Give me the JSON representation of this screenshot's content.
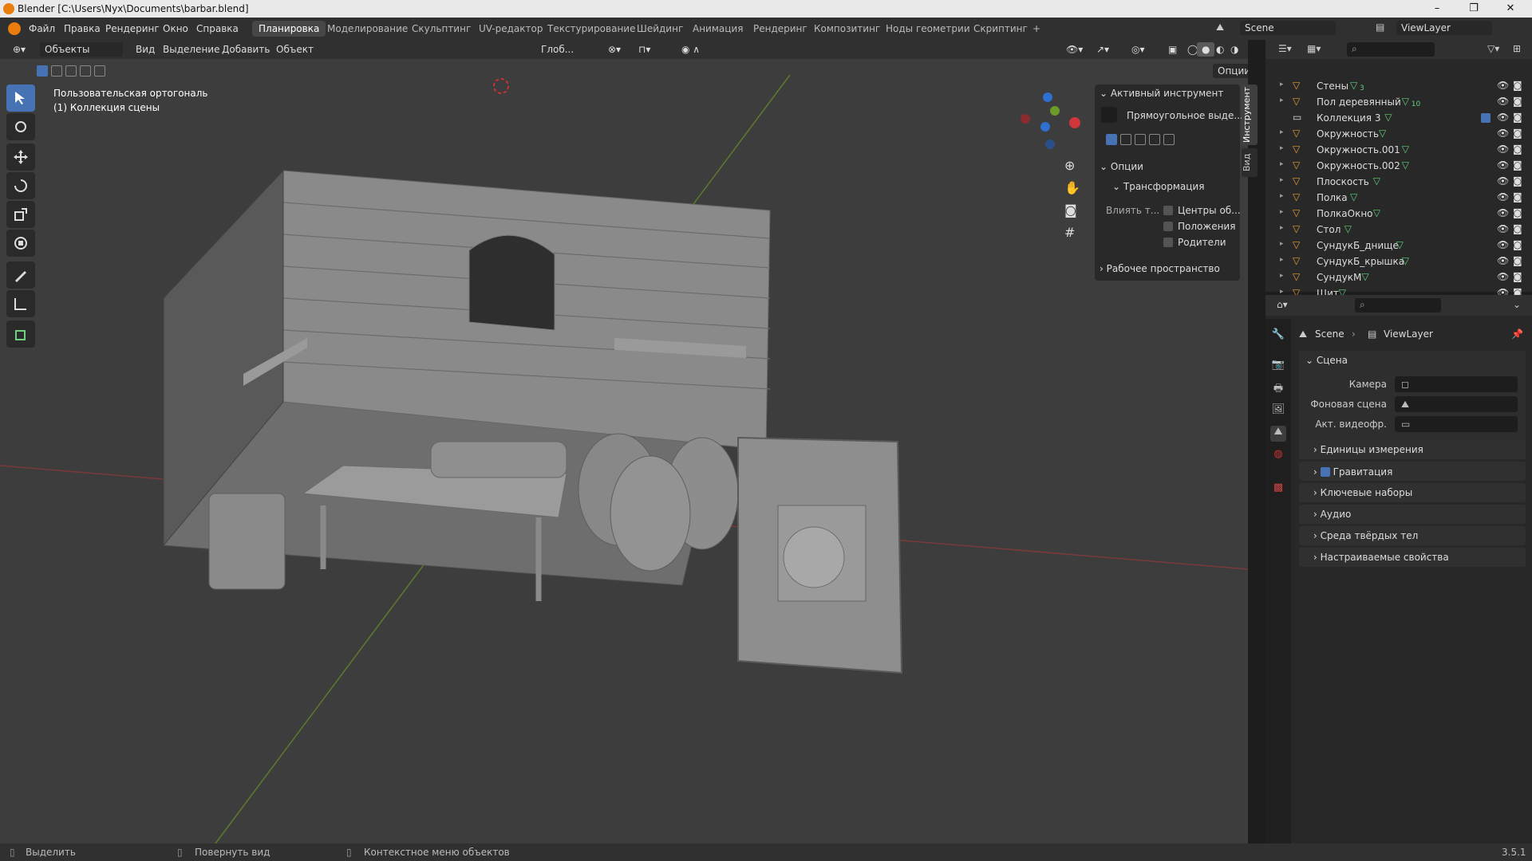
{
  "window": {
    "title": "Blender [C:\\Users\\Nyx\\Documents\\barbar.blend]",
    "min": "–",
    "max": "❐",
    "close": "✕"
  },
  "menu": [
    "Файл",
    "Правка",
    "Рендеринг",
    "Окно",
    "Справка"
  ],
  "workspaces": [
    "Планировка",
    "Моделирование",
    "Скульптинг",
    "UV-редактор",
    "Текстурирование",
    "Шейдинг",
    "Анимация",
    "Рендеринг",
    "Композитинг",
    "Ноды геометрии",
    "Скриптинг",
    "+"
  ],
  "scene": {
    "name": "Scene",
    "view_layer": "ViewLayer"
  },
  "header3d": {
    "mode": "Объекты",
    "view": "Вид",
    "select": "Выделение",
    "add": "Добавить",
    "object": "Объект",
    "orientation": "Глоб...",
    "options": "Опции"
  },
  "viewport": {
    "view_name": "Пользовательская ортогональ",
    "collection": "(1) Коллекция сцены"
  },
  "npanel": {
    "active_tool": "Активный инструмент",
    "tool_name": "Прямоугольное выде...",
    "options": "Опции",
    "transform": "Трансформация",
    "affect": "Влиять т...",
    "centers": "Центры об...",
    "locations": "Положения",
    "parents": "Родители",
    "workspace": "Рабочее пространство",
    "tabs": [
      "Инструмент",
      "Вид"
    ]
  },
  "outliner": {
    "rows": [
      {
        "name": "Стены",
        "type": "mesh",
        "mods": "3",
        "arrow": "▸"
      },
      {
        "name": "Пол деревянный",
        "type": "mesh",
        "mods": "10",
        "arrow": "▸"
      },
      {
        "name": "Коллекция 3",
        "type": "collection",
        "mods": "",
        "arrow": ""
      },
      {
        "name": "Окружность",
        "type": "mesh",
        "mods": "",
        "arrow": "▸"
      },
      {
        "name": "Окружность.001",
        "type": "mesh",
        "mods": "",
        "arrow": "▸"
      },
      {
        "name": "Окружность.002",
        "type": "mesh",
        "mods": "",
        "arrow": "▸"
      },
      {
        "name": "Плоскость",
        "type": "mesh",
        "mods": "",
        "arrow": "▸"
      },
      {
        "name": "Полка",
        "type": "mesh",
        "mods": "",
        "arrow": "▸"
      },
      {
        "name": "ПолкаОкно",
        "type": "mesh",
        "mods": "",
        "arrow": "▸"
      },
      {
        "name": "Стол",
        "type": "mesh",
        "mods": "",
        "arrow": "▸"
      },
      {
        "name": "СундукБ_днище",
        "type": "mesh",
        "mods": "",
        "arrow": "▸"
      },
      {
        "name": "СундукБ_крышка",
        "type": "mesh",
        "mods": "",
        "arrow": "▸"
      },
      {
        "name": "СундукМ",
        "type": "mesh",
        "mods": "",
        "arrow": "▸"
      },
      {
        "name": "Щит",
        "type": "mesh",
        "mods": "",
        "arrow": "▸"
      }
    ]
  },
  "properties": {
    "breadcrumb_scene": "Scene",
    "breadcrumb_layer": "ViewLayer",
    "section": "Сцена",
    "camera": "Камера",
    "bg_scene": "Фоновая сцена",
    "active_clip": "Акт. видеофр.",
    "gravity_checked": true,
    "sections": [
      "Единицы измерения",
      "Гравитация",
      "Ключевые наборы",
      "Аудио",
      "Среда твёрдых тел",
      "Настраиваемые свойства"
    ]
  },
  "status": {
    "select": "Выделить",
    "rotate": "Повернуть вид",
    "context": "Контекстное меню объектов",
    "version": "3.5.1"
  },
  "colors": {
    "accent": "#4772b3",
    "mesh": "#e69a3a",
    "modifier": "#5fd07a"
  }
}
